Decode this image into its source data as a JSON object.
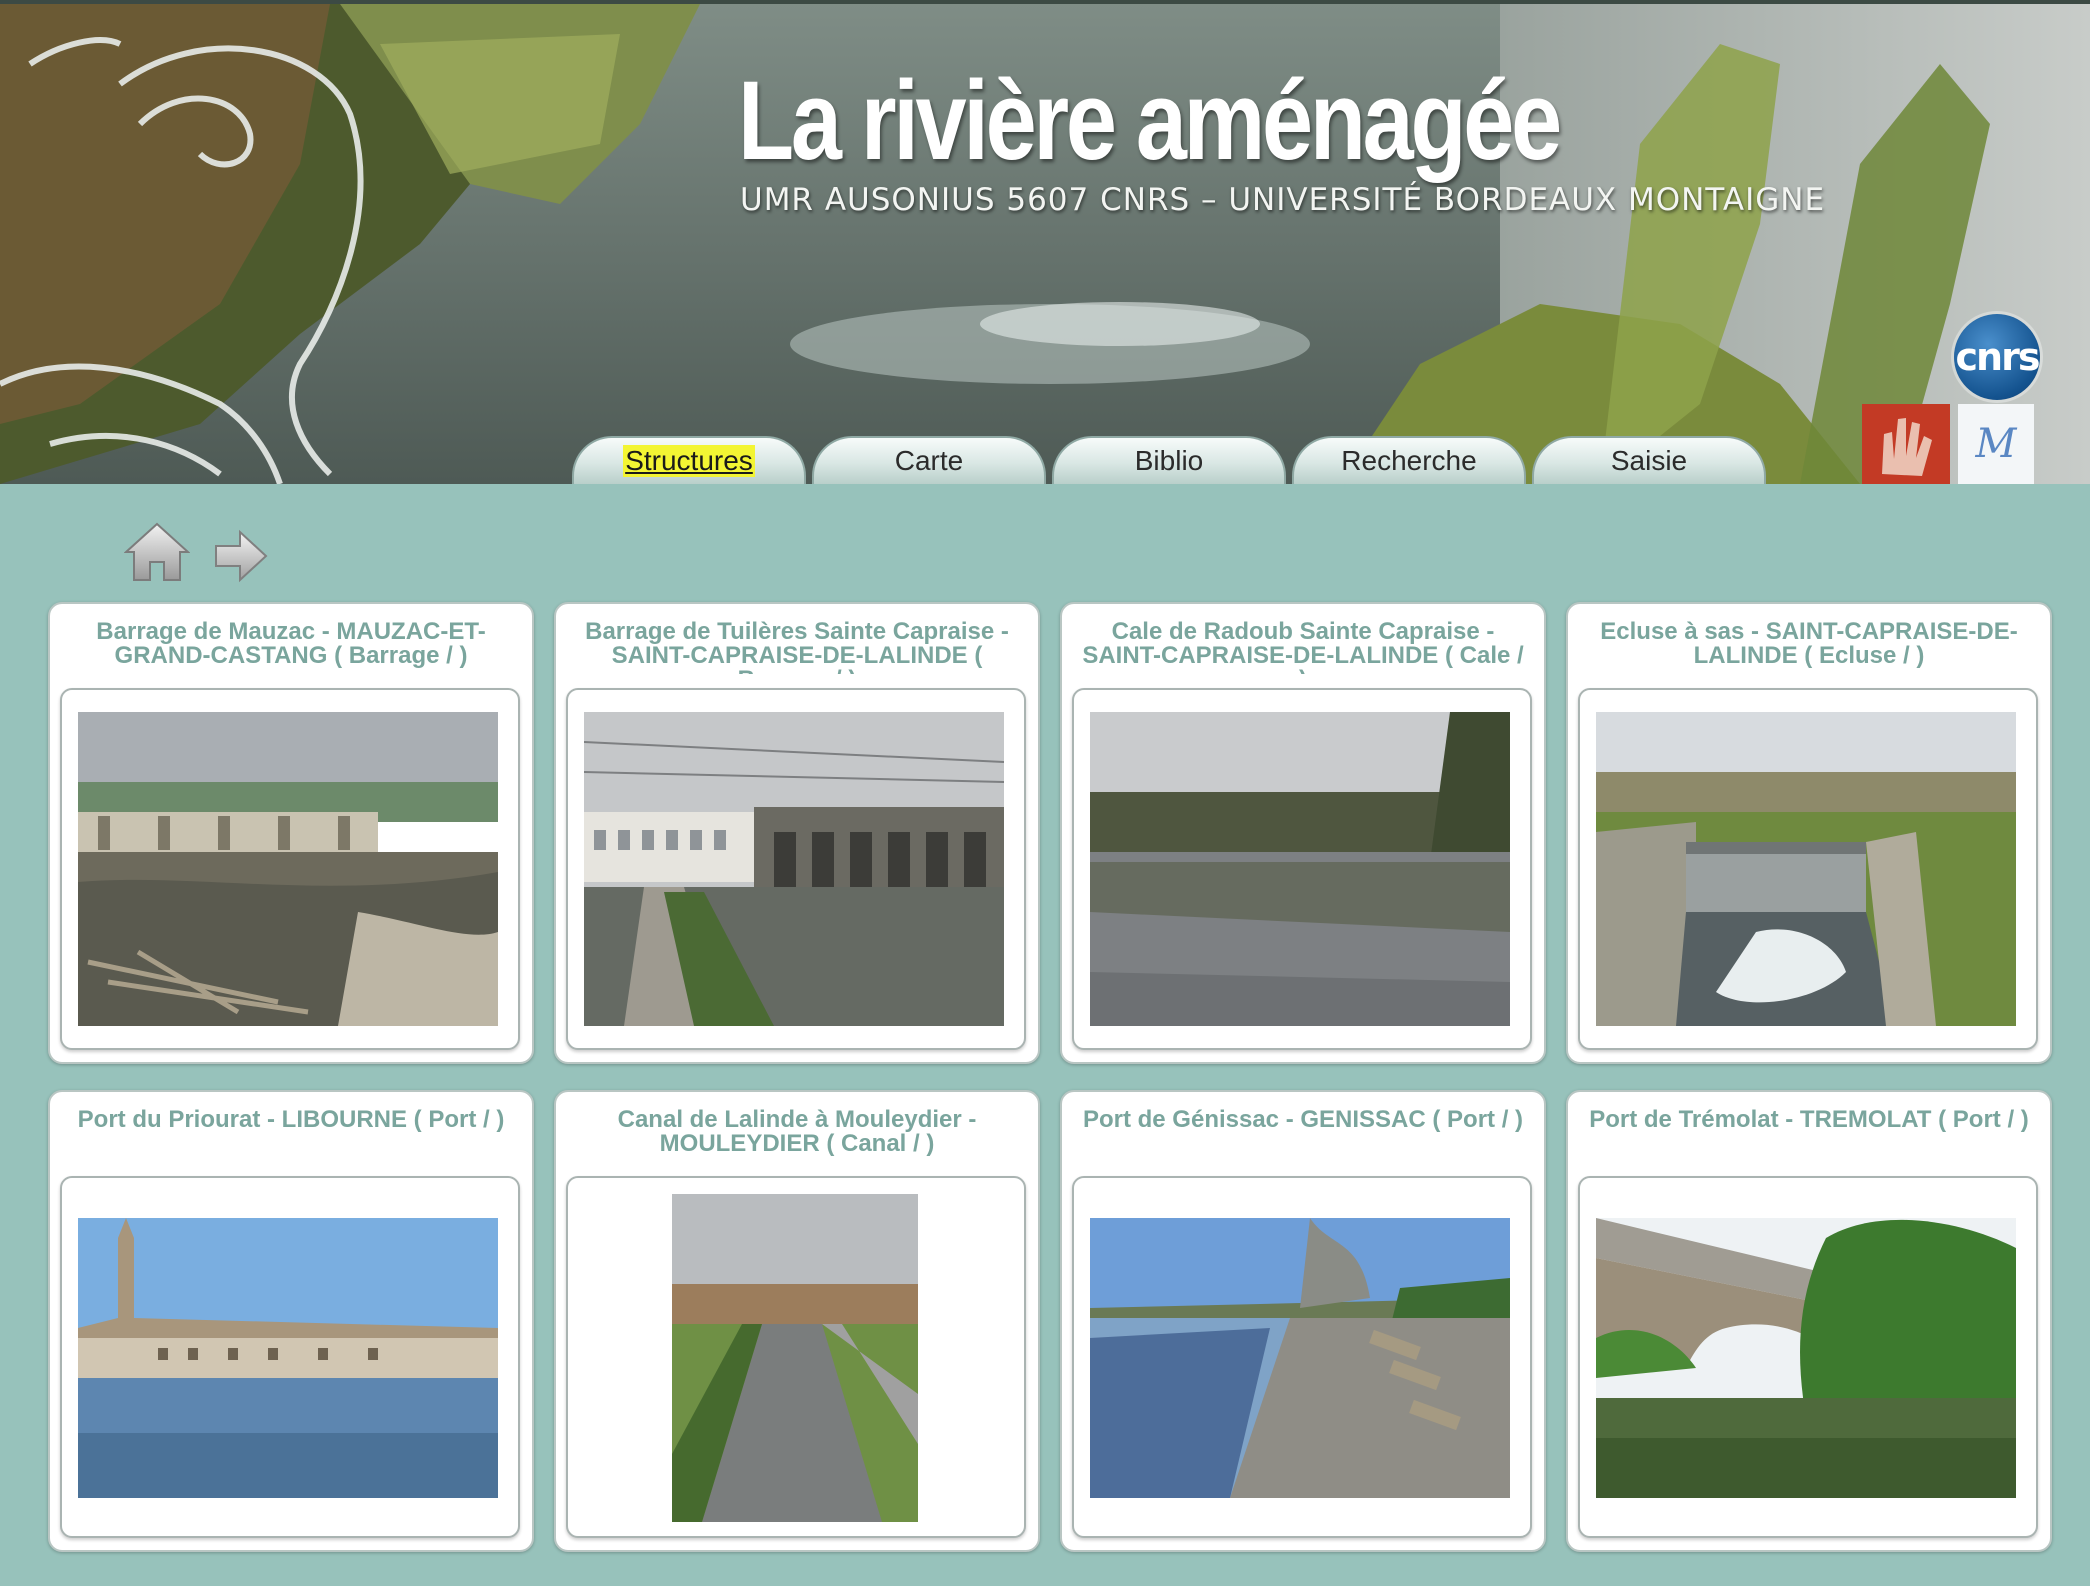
{
  "header": {
    "title": "La rivière aménagée",
    "subtitle": "UMR AUSONIUS 5607 CNRS – UNIVERSITÉ BORDEAUX MONTAIGNE",
    "cnrs_logo_text": "cnrs"
  },
  "tabs": [
    {
      "label": "Structures",
      "active": true
    },
    {
      "label": "Carte",
      "active": false
    },
    {
      "label": "Biblio",
      "active": false
    },
    {
      "label": "Recherche",
      "active": false
    },
    {
      "label": "Saisie",
      "active": false
    }
  ],
  "nav": {
    "home_icon": "home-icon",
    "next_icon": "arrow-right-icon"
  },
  "cards": [
    {
      "title": "Barrage de Mauzac - MAUZAC-ET-GRAND-CASTANG ( Barrage /  )",
      "photo": "dam-river"
    },
    {
      "title": "Barrage de Tuilères Sainte Capraise - SAINT-CAPRAISE-DE-LALINDE ( Barrage /  )",
      "photo": "dam-building"
    },
    {
      "title": "Cale de Radoub Sainte Capraise - SAINT-CAPRAISE-DE-LALINDE ( Cale /  )",
      "photo": "canal-reflection"
    },
    {
      "title": "Ecluse à sas  - SAINT-CAPRAISE-DE-LALINDE ( Ecluse /  )",
      "photo": "lock-gate"
    },
    {
      "title": "Port du Priourat - LIBOURNE ( Port /  )",
      "photo": "town-riverside"
    },
    {
      "title": "Canal de Lalinde à Mouleydier - MOULEYDIER ( Canal /  )",
      "photo": "canal-village"
    },
    {
      "title": "Port de Génissac - GENISSAC ( Port /  )",
      "photo": "river-quay"
    },
    {
      "title": "Port de Trémolat - TREMOLAT ( Port /  )",
      "photo": "bridge-arch"
    }
  ],
  "colors": {
    "page_background": "#97c2bb",
    "card_title": "#7aa59d",
    "active_tab_highlight": "#f3f533"
  }
}
